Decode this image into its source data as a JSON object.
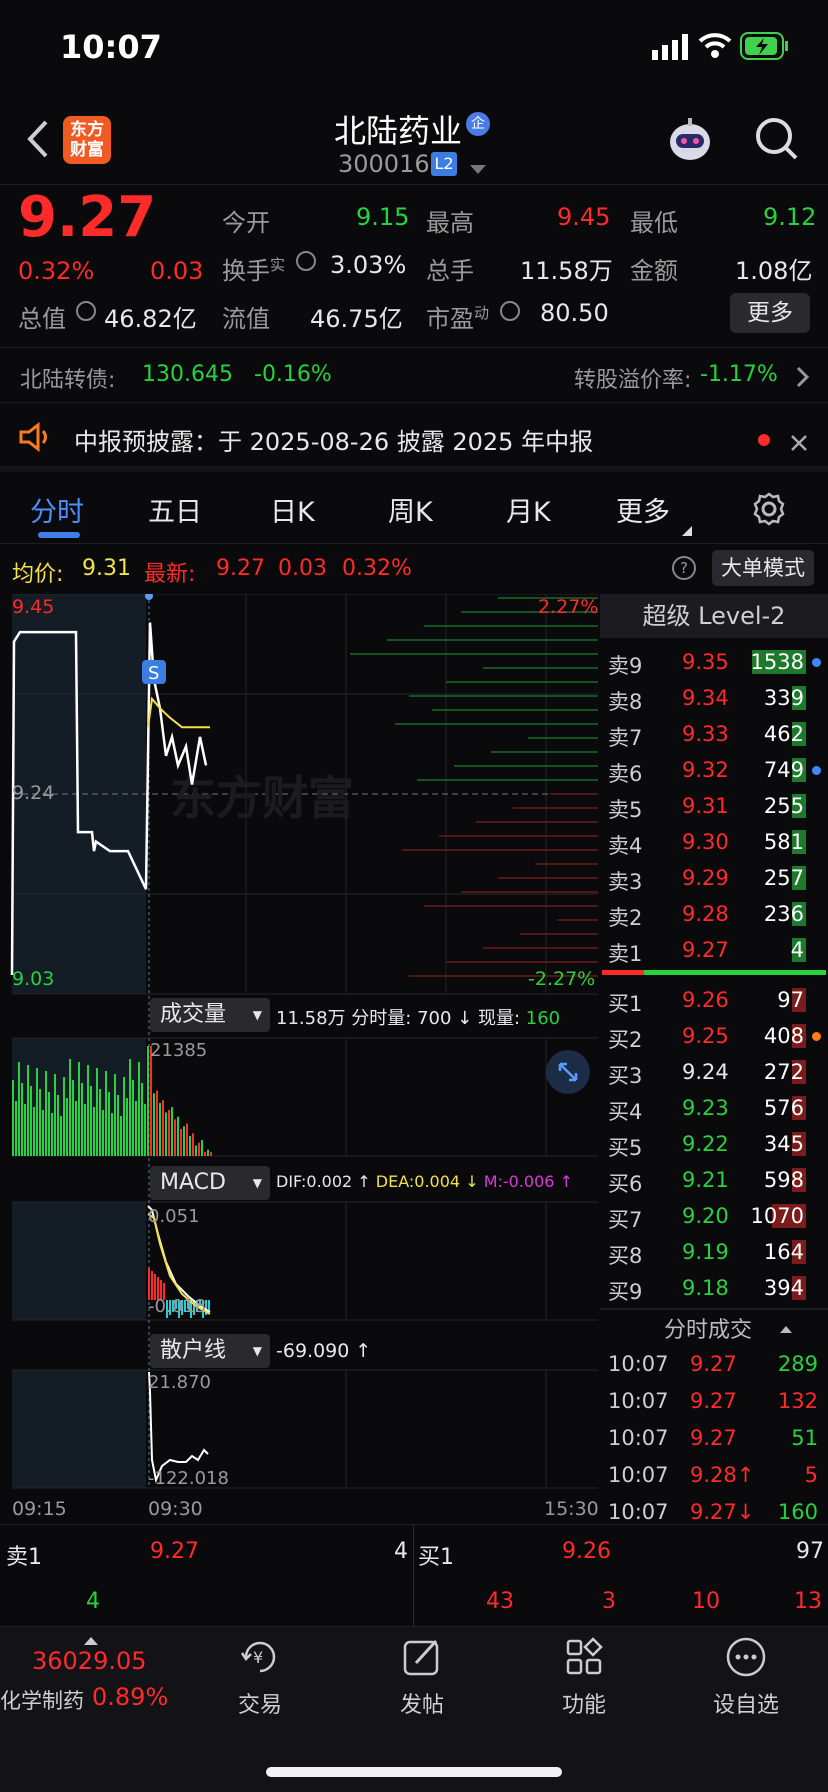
{
  "status": {
    "time": "10:07"
  },
  "header": {
    "logo_line1": "东方",
    "logo_line2": "财富",
    "stock_name": "北陆药业",
    "enterprise_badge": "企",
    "stock_code": "300016",
    "level_badge": "L2",
    "icons": [
      "back-icon",
      "robot-icon",
      "search-icon"
    ]
  },
  "quote": {
    "price": "9.27",
    "change_pct": "0.32%",
    "change": "0.03",
    "open_label": "今开",
    "open": "9.15",
    "high_label": "最高",
    "high": "9.45",
    "low_label": "最低",
    "low": "9.12",
    "turnover_label": "换手",
    "turnover_sup": "实",
    "turnover": "3.03%",
    "volume_label": "总手",
    "volume": "11.58万",
    "amount_label": "金额",
    "amount": "1.08亿",
    "mktcap_label": "总值",
    "mktcap": "46.82亿",
    "float_label": "流值",
    "float": "46.75亿",
    "pe_label": "市盈",
    "pe_sup": "动",
    "pe": "80.50",
    "more_button": "更多"
  },
  "bond": {
    "label": "北陆转债:",
    "price": "130.645",
    "change": "-0.16%",
    "premium_label": "转股溢价率:",
    "premium": "-1.17%"
  },
  "notice": {
    "text": "中报预披露：于 2025-08-26 披露 2025 年中报"
  },
  "tabs": [
    "分时",
    "五日",
    "日K",
    "周K",
    "月K",
    "更多"
  ],
  "infoline": {
    "avg_label": "均价:",
    "avg": "9.31",
    "last_label": "最新:",
    "last": "9.27",
    "chg": "0.03",
    "pct": "0.32%",
    "mode_button": "大单模式"
  },
  "intraday": {
    "price_high": "9.45",
    "price_low": "9.03",
    "price_mid": "9.24",
    "pct_high": "2.27%",
    "pct_low": "-2.27%",
    "watermark": "东方财富",
    "signal": "S",
    "price_series": [
      9.05,
      9.4,
      9.41,
      9.41,
      9.41,
      9.2,
      9.2,
      9.18,
      9.19,
      9.18,
      9.18,
      9.14,
      9.42,
      9.36,
      9.33,
      9.28,
      9.3,
      9.27,
      9.29,
      9.25,
      9.3,
      9.27
    ],
    "avg_series": [
      9.31,
      9.34,
      9.33,
      9.32,
      9.31,
      9.31,
      9.31,
      9.31
    ]
  },
  "volume_panel": {
    "button": "成交量",
    "total": "11.58万",
    "minute_label": "分时量:",
    "minute": "700",
    "current_label": "现量:",
    "current": "160",
    "max": "21385"
  },
  "macd_panel": {
    "button": "MACD",
    "dif": "DIF:0.002",
    "dea": "DEA:0.004",
    "m": "M:-0.006",
    "max": "0.051",
    "min": "-0.018"
  },
  "retail_panel": {
    "button": "散户线",
    "value": "-69.090",
    "max": "21.870",
    "min": "-122.018"
  },
  "time_axis": [
    "09:15",
    "09:30",
    "15:30"
  ],
  "level2": {
    "title": "超级 Level-2",
    "asks": [
      {
        "label": "卖9",
        "price": "9.35",
        "vol": "1538",
        "dot": "#3d8bff"
      },
      {
        "label": "卖8",
        "price": "9.34",
        "vol": "339",
        "dot": ""
      },
      {
        "label": "卖7",
        "price": "9.33",
        "vol": "462",
        "dot": ""
      },
      {
        "label": "卖6",
        "price": "9.32",
        "vol": "749",
        "dot": "#3d8bff"
      },
      {
        "label": "卖5",
        "price": "9.31",
        "vol": "255",
        "dot": ""
      },
      {
        "label": "卖4",
        "price": "9.30",
        "vol": "581",
        "dot": ""
      },
      {
        "label": "卖3",
        "price": "9.29",
        "vol": "257",
        "dot": ""
      },
      {
        "label": "卖2",
        "price": "9.28",
        "vol": "236",
        "dot": ""
      },
      {
        "label": "卖1",
        "price": "9.27",
        "vol": "4",
        "dot": ""
      }
    ],
    "bids": [
      {
        "label": "买1",
        "price": "9.26",
        "vol": "97",
        "pc": "red",
        "dot": ""
      },
      {
        "label": "买2",
        "price": "9.25",
        "vol": "408",
        "pc": "red",
        "dot": "#ff7a1a"
      },
      {
        "label": "买3",
        "price": "9.24",
        "vol": "272",
        "pc": "wht",
        "dot": ""
      },
      {
        "label": "买4",
        "price": "9.23",
        "vol": "576",
        "pc": "grn",
        "dot": ""
      },
      {
        "label": "买5",
        "price": "9.22",
        "vol": "345",
        "pc": "grn",
        "dot": ""
      },
      {
        "label": "买6",
        "price": "9.21",
        "vol": "598",
        "pc": "grn",
        "dot": ""
      },
      {
        "label": "买7",
        "price": "9.20",
        "vol": "1070",
        "pc": "grn",
        "dot": ""
      },
      {
        "label": "买8",
        "price": "9.19",
        "vol": "164",
        "pc": "grn",
        "dot": ""
      },
      {
        "label": "买9",
        "price": "9.18",
        "vol": "394",
        "pc": "grn",
        "dot": ""
      }
    ],
    "ticks_title": "分时成交",
    "ticks": [
      {
        "time": "10:07",
        "price": "9.27",
        "vol": "289",
        "vc": "grn"
      },
      {
        "time": "10:07",
        "price": "9.27",
        "vol": "132",
        "vc": "red"
      },
      {
        "time": "10:07",
        "price": "9.27",
        "vol": "51",
        "vc": "grn"
      },
      {
        "time": "10:07",
        "price": "9.28↑",
        "vol": "5",
        "vc": "red"
      },
      {
        "time": "10:07",
        "price": "9.27↓",
        "vol": "160",
        "vc": "grn"
      }
    ]
  },
  "bottom_book": {
    "ask_label": "卖1",
    "ask_price": "9.27",
    "ask_vol": "4",
    "bid_label": "买1",
    "bid_price": "9.26",
    "bid_vol": "97",
    "ask_queue": [
      "4"
    ],
    "bid_queue": [
      "43",
      "3",
      "10",
      "13"
    ]
  },
  "tabbar": {
    "index_value": "36029.05",
    "index_name": "化学制药",
    "index_pct": "0.89%",
    "items": [
      "交易",
      "发帖",
      "功能",
      "设自选"
    ]
  }
}
